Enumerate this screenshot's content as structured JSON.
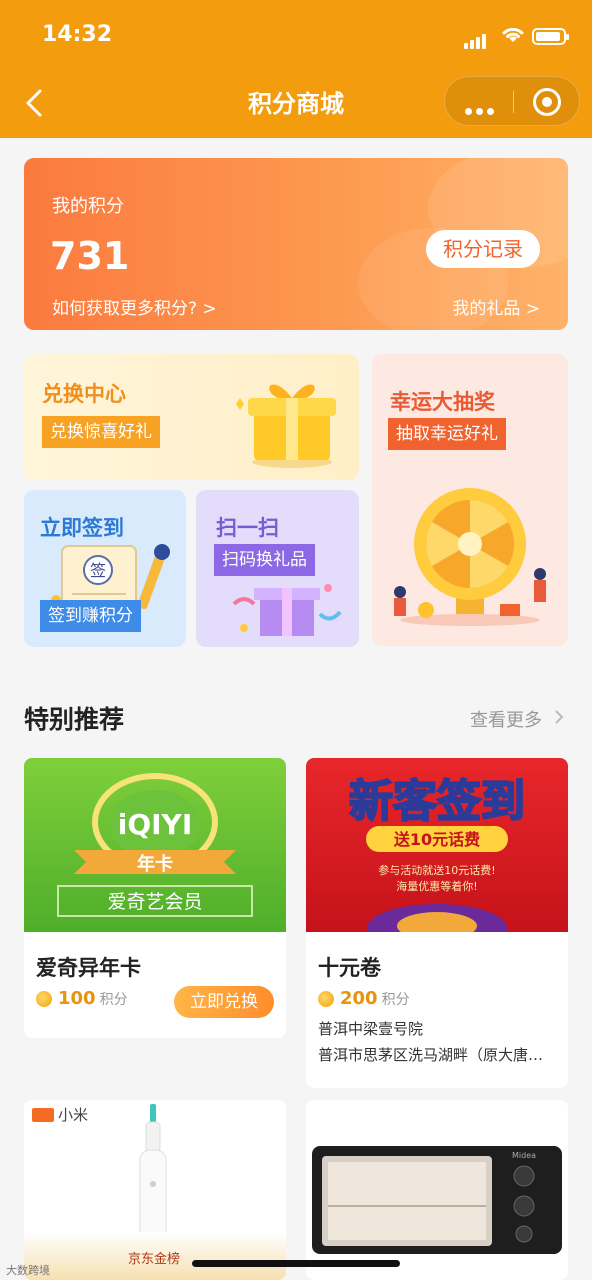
{
  "status_bar": {
    "time": "14:32"
  },
  "nav": {
    "title": "积分商城"
  },
  "points": {
    "label": "我的积分",
    "value": "731",
    "record_button": "积分记录",
    "how_link": "如何获取更多积分? >",
    "gifts_link": "我的礼品 >"
  },
  "features": {
    "exchange": {
      "title": "兑换中心",
      "tag": "兑换惊喜好礼"
    },
    "lottery": {
      "title": "幸运大抽奖",
      "tag": "抽取幸运好礼"
    },
    "signin": {
      "title": "立即签到",
      "tag": "签到赚积分",
      "stamp": "签"
    },
    "scan": {
      "title": "扫一扫",
      "tag": "扫码换礼品"
    }
  },
  "section": {
    "title": "特别推荐",
    "more": "查看更多"
  },
  "products": [
    {
      "name": "爱奇异年卡",
      "price": "100",
      "unit": "积分",
      "button": "立即兑换",
      "banner_logo": "iQIYI",
      "banner_ribbon": "年卡",
      "banner_text": "爱奇艺会员"
    },
    {
      "name": "十元卷",
      "price": "200",
      "unit": "积分",
      "store": "普洱中梁壹号院",
      "address": "普洱市思茅区洗马湖畔（原大唐…",
      "banner_title": "新客签到",
      "banner_sub": "送10元话费",
      "banner_line1": "参与活动就送10元话费!",
      "banner_line2": "海量优惠等着你!"
    },
    {
      "brand": "小米",
      "banner_footer": "京东金榜"
    },
    {
      "brand": "Midea"
    }
  ],
  "watermark": "大数跨境",
  "colors": {
    "header": "#f39c0d",
    "accent": "#f0642a",
    "price": "#e8930c"
  }
}
